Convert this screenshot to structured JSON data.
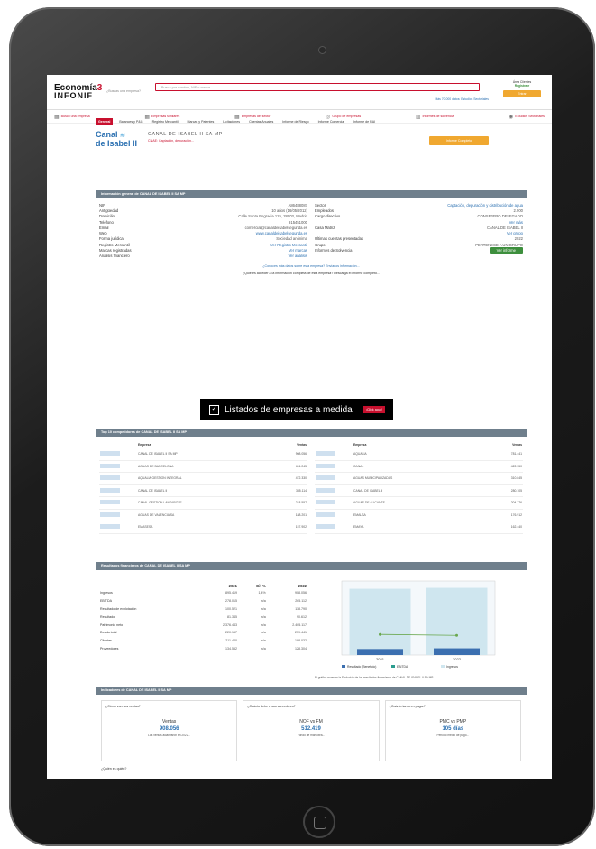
{
  "header": {
    "logo_line1": "Economía",
    "logo_num": "3",
    "logo_line2": "INFONIF",
    "tagline": "¿Buscas una empresa?",
    "search_placeholder": "Busca por nombre, NIF o marca",
    "toplinks": "Más 70.000 datos: Estudios Sectoriales",
    "login_label": "Área Clientes",
    "login_status": "Registrate",
    "login_btn": "Entrar"
  },
  "nav": [
    {
      "label": "Busco una empresa",
      "icon": "building-icon"
    },
    {
      "label": "Empresas similares",
      "icon": "building-icon"
    },
    {
      "label": "Empresas del sector",
      "icon": "building-icon"
    },
    {
      "label": "Grupo de empresas",
      "icon": "globe-icon"
    },
    {
      "label": "Informes de solvencia",
      "icon": "chart-icon"
    },
    {
      "label": "Estudios Sectoriales",
      "icon": "target-icon"
    }
  ],
  "company": {
    "logo_top": "Canal",
    "logo_bottom": "de Isabel II",
    "name": "CANAL DE ISABEL II SA MP",
    "subtitle": "CNAE: Captación, depuración...",
    "report_btn": "Informe Completo"
  },
  "tabs": [
    "General",
    "Balances y P&G",
    "Registro Mercantil",
    "Marcas y Patentes",
    "Licitaciones",
    "Cuentas Anuales",
    "Informe de Riesgo",
    "Informe Comercial",
    "Informe de RAI"
  ],
  "info_section": {
    "title": "Información general de CANAL DE ISABEL II SA MP",
    "left": [
      {
        "k": "NIF",
        "v": "A86488087",
        "link": false
      },
      {
        "k": "Antigüedad",
        "v": "10 años (16/05/2012)",
        "link": false
      },
      {
        "k": "Domicilio",
        "v": "Calle Santa Engracia 125, 28003, Madrid",
        "link": false
      },
      {
        "k": "Teléfono",
        "v": "915451000",
        "link": false
      },
      {
        "k": "Email",
        "v": "comercial@canaldeisabelsegunda.es",
        "link": false
      },
      {
        "k": "Web",
        "v": "www.canaldeisabelsegunda.es",
        "link": true
      },
      {
        "k": "Forma jurídica",
        "v": "Sociedad anónima",
        "link": false
      },
      {
        "k": "Registro Mercantil",
        "v": "Ver Registro Mercantil",
        "link": true
      },
      {
        "k": "Marcas registradas",
        "v": "Ver marcas",
        "link": true
      },
      {
        "k": "Análisis financiero",
        "v": "Ver análisis",
        "link": true
      }
    ],
    "right": [
      {
        "k": "Sector",
        "v": "Captación, depuración y distribución de agua",
        "link": true
      },
      {
        "k": "Empleados",
        "v": "2.900",
        "link": false
      },
      {
        "k": "Cargo directivo",
        "v": "CONSEJERO DELEGADO",
        "link": false
      },
      {
        "k": "",
        "v": "Ver más",
        "link": true
      },
      {
        "k": "Casa Matriz",
        "v": "CANAL DE ISABEL II",
        "link": false
      },
      {
        "k": "",
        "v": "Ver grupo",
        "link": true
      },
      {
        "k": "Últimas cuentas presentadas",
        "v": "2022",
        "link": false
      },
      {
        "k": "Grupo",
        "v": "PERTENECE A UN GRUPO",
        "link": false
      },
      {
        "k": "Informes de Solvencia",
        "v": "Ver informe",
        "link": false,
        "button": true
      }
    ],
    "note1": "¿Conoces más datos sobre esta empresa? Envíanos información...",
    "note2": "¿Quieres acceder a la información completa de esta empresa? Descarga el informe completo..."
  },
  "banner": {
    "text": "Listados de empresas a medida",
    "cta": "¡Click aquí!"
  },
  "competitors": {
    "title": "Top 10 competidores de CANAL DE ISABEL II SA MP",
    "left_header": [
      "Empresa",
      "Ventas"
    ],
    "right_header": [
      "Empresa",
      "Ventas"
    ],
    "left_rows": [
      {
        "name": "CANAL DE ISABEL II SA MP",
        "v": "908.056"
      },
      {
        "name": "AGUAS DE BARCELONA",
        "v": "611.245"
      },
      {
        "name": "AQUALIA GESTION INTEGRAL",
        "v": "472.330"
      },
      {
        "name": "CANAL DE ISABEL II",
        "v": "385.114"
      },
      {
        "name": "CANAL GESTION LANZAROTE",
        "v": "218.557"
      },
      {
        "name": "AGUAS DE VALENCIA SA",
        "v": "188.201"
      },
      {
        "name": "EMASESA",
        "v": "157.902"
      }
    ],
    "right_rows": [
      {
        "name": "AQUALIA",
        "v": "781.441"
      },
      {
        "name": "CANAL",
        "v": "422.350"
      },
      {
        "name": "AGUAS MUNICIPALIZADAS",
        "v": "310.845"
      },
      {
        "name": "CANAL DE ISABEL II",
        "v": "280.105"
      },
      {
        "name": "AGUAS DE ALICANTE",
        "v": "204.776"
      },
      {
        "name": "EMALSA",
        "v": "176.912"
      },
      {
        "name": "EMAYA",
        "v": "162.440"
      }
    ]
  },
  "financials": {
    "title": "Resultados financieros de CANAL DE ISABEL II SA MP",
    "cols": [
      "2021",
      "Dif %",
      "2022"
    ],
    "rows": [
      {
        "k": "Ingresos",
        "a": "895.419",
        "d": "1,4%",
        "b": "908.056"
      },
      {
        "k": "EBITDA",
        "a": "278.015",
        "d": "n/a",
        "b": "265.112"
      },
      {
        "k": "Resultado de explotación",
        "a": "100.521",
        "d": "n/a",
        "b": "118.790"
      },
      {
        "k": "Resultado",
        "a": "81.345",
        "d": "n/a",
        "b": "90.612"
      },
      {
        "k": "Patrimonio neto",
        "a": "2.376.443",
        "d": "n/a",
        "b": "2.405.117"
      },
      {
        "k": "Deuda total",
        "a": "220.157",
        "d": "n/a",
        "b": "239.441"
      },
      {
        "k": "Clientes",
        "a": "211.420",
        "d": "n/a",
        "b": "198.032"
      },
      {
        "k": "Proveedores",
        "a": "134.552",
        "d": "n/a",
        "b": "128.304"
      }
    ],
    "chart_legend": [
      "Resultado (Beneficio)",
      "EBITDA",
      "Ingresos"
    ],
    "chart_years": [
      "2021",
      "2022"
    ],
    "chart_note": "El gráfico muestra la Evolución de los resultados financieros de CANAL DE ISABEL II SA MP..."
  },
  "metrics": {
    "title": "Indicadores de CANAL DE ISABEL II SA MP",
    "cards": [
      {
        "h": "¿Cómo van sus ventas?",
        "t": "Ventas",
        "big": "908.056",
        "s": "Las ventas alcanzaron en 2022..."
      },
      {
        "h": "¿Cuánto debe a sus acreedores?",
        "t": "NOF vs FM",
        "big": "512.419",
        "s": "Fondo de maniobra..."
      },
      {
        "h": "¿Cuánto tarda en pagar?",
        "t": "PMC vs PMP",
        "big": "105 días",
        "s": "Periodo medio de pago..."
      }
    ],
    "last_label": "¿Quién es quién?"
  },
  "chart_data": {
    "type": "bar",
    "categories": [
      "2021",
      "2022"
    ],
    "series": [
      {
        "name": "Resultado (Beneficio)",
        "values": [
          81345,
          90612
        ]
      },
      {
        "name": "EBITDA",
        "values": [
          278015,
          265112
        ]
      },
      {
        "name": "Ingresos",
        "values": [
          895419,
          908056
        ]
      }
    ],
    "title": "",
    "xlabel": "",
    "ylabel": "",
    "ylim": [
      0,
      1000000
    ],
    "legend": "bottom"
  }
}
